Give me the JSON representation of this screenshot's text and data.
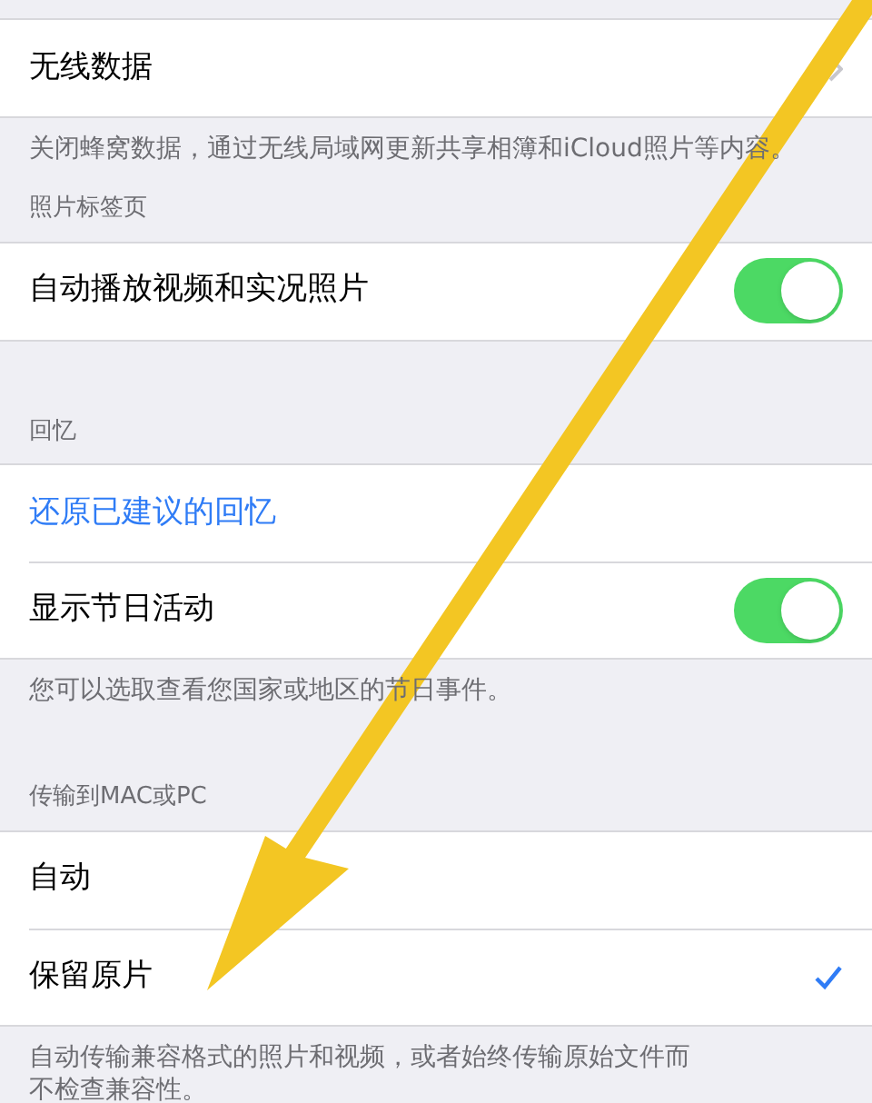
{
  "sections": [
    {
      "rows": [
        {
          "kind": "link",
          "label": "无线数据"
        }
      ],
      "footer": "关闭蜂窝数据，通过无线局域网更新共享相簿和iCloud照片等内容。"
    },
    {
      "header": "照片标签页",
      "rows": [
        {
          "kind": "toggle",
          "label": "自动播放视频和实况照片",
          "on": true
        }
      ]
    },
    {
      "header": "回忆",
      "rows": [
        {
          "kind": "action",
          "label": "还原已建议的回忆"
        },
        {
          "kind": "toggle",
          "label": "显示节日活动",
          "on": true
        }
      ],
      "footer": "您可以选取查看您国家或地区的节日事件。"
    },
    {
      "header": "传输到MAC或PC",
      "rows": [
        {
          "kind": "option",
          "label": "自动",
          "selected": false
        },
        {
          "kind": "option",
          "label": "保留原片",
          "selected": true
        }
      ],
      "footer": "自动传输兼容格式的照片和视频，或者始终传输原始文件而不检查兼容性。"
    }
  ]
}
